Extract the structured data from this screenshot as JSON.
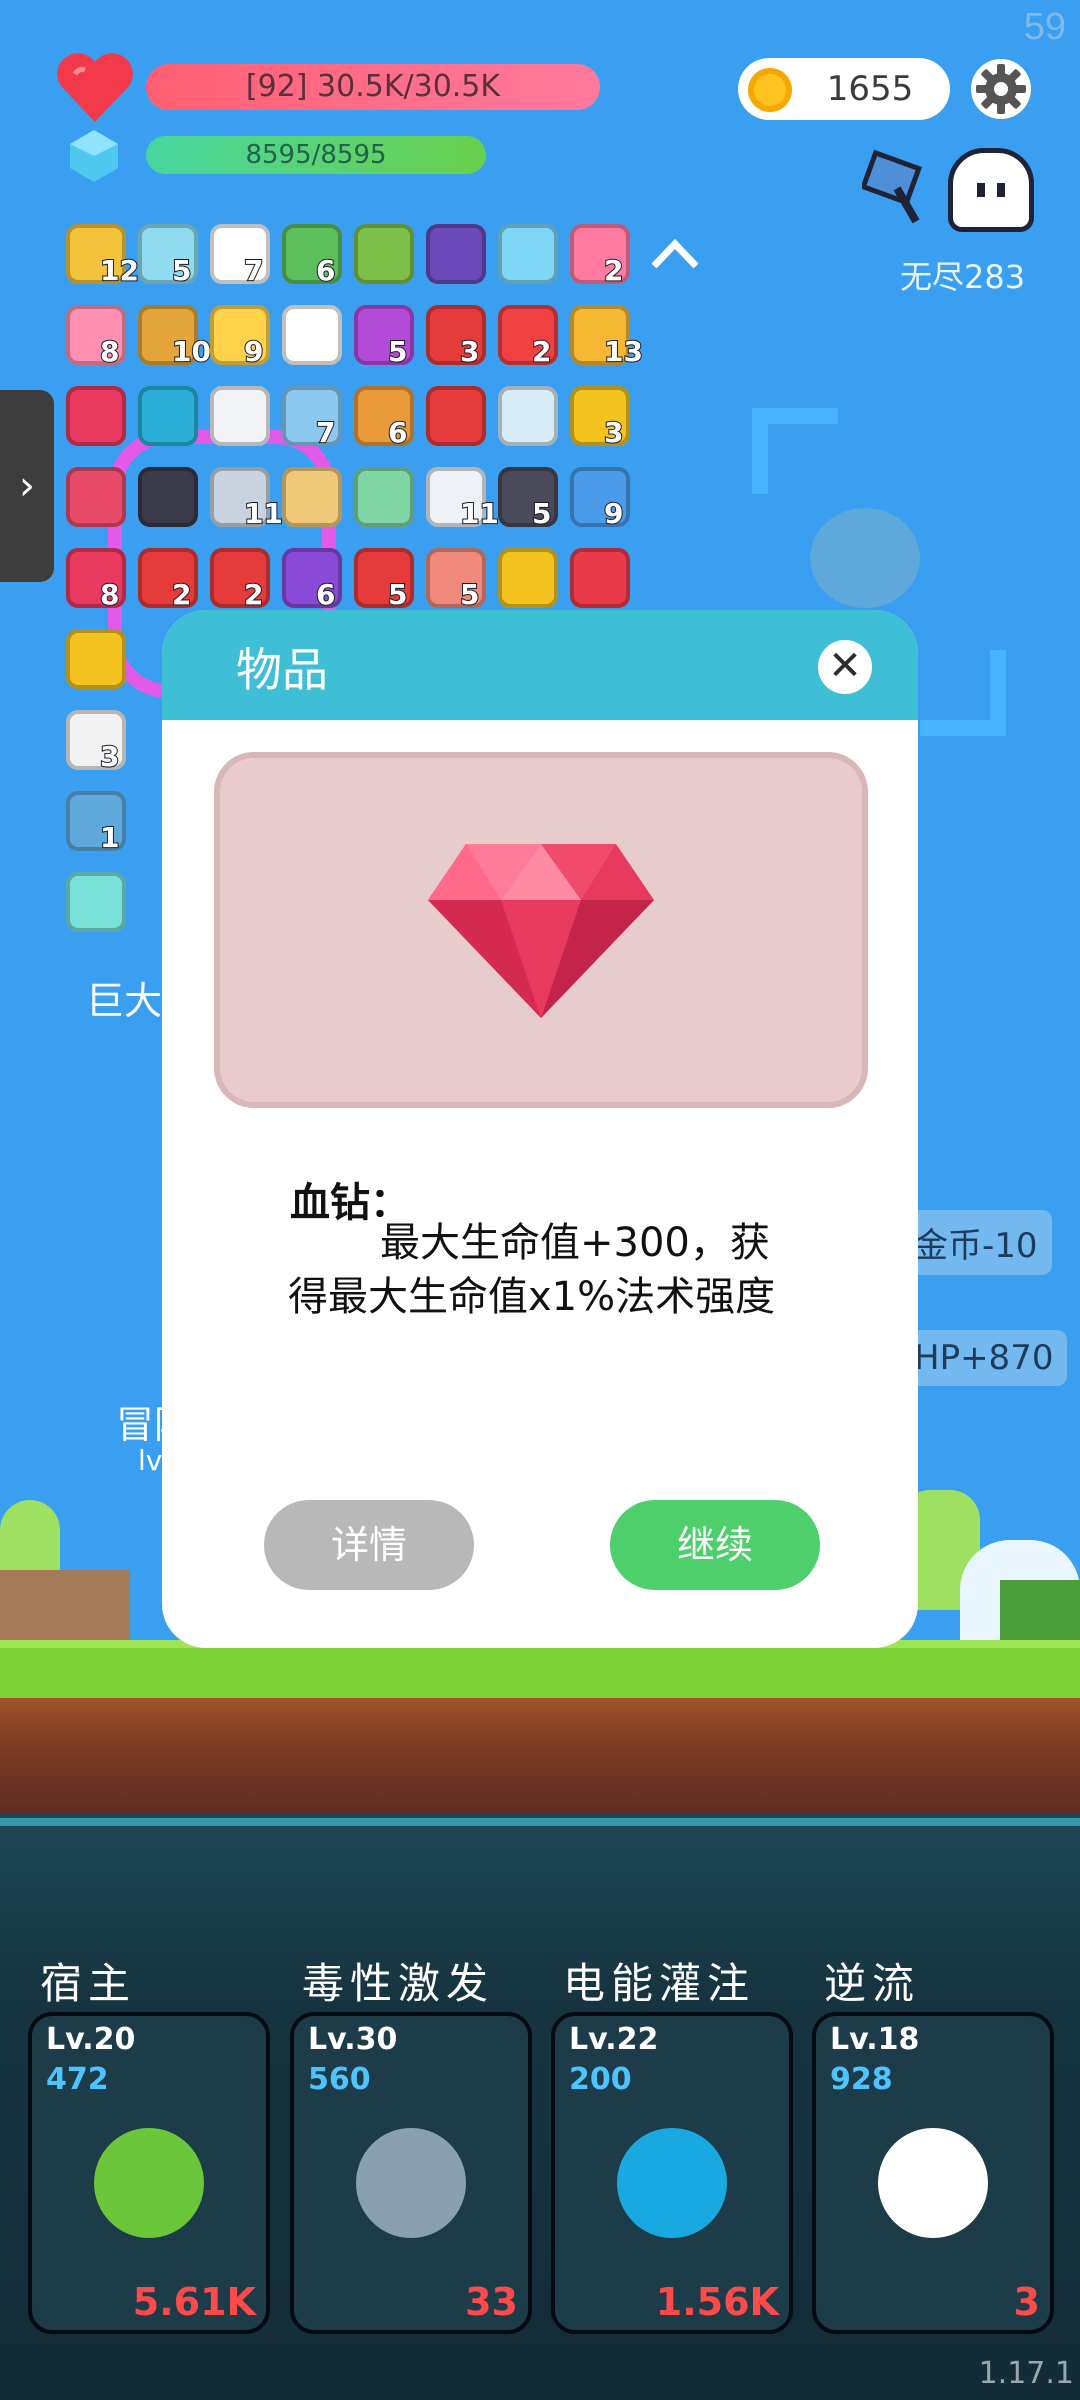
{
  "hud": {
    "fps": "59",
    "hp_text": "[92] 30.5K/30.5K",
    "mp_text": "8595/8595",
    "coins": "1655",
    "endless_label": "无尽283"
  },
  "inventory": {
    "items": [
      {
        "icon": "durian-icon",
        "count": "12",
        "color": "#f3c23b"
      },
      {
        "icon": "syringe-icon",
        "count": "5",
        "color": "#8fdcf0"
      },
      {
        "icon": "ghost-icon",
        "count": "7",
        "color": "#ffffff"
      },
      {
        "icon": "cash-heart-icon",
        "count": "6",
        "color": "#5bbf5b"
      },
      {
        "icon": "potion-flask-icon",
        "count": "",
        "color": "#7cc04a"
      },
      {
        "icon": "wizard-hat-icon",
        "count": "",
        "color": "#6a4ab8"
      },
      {
        "icon": "blue-orb-icon",
        "count": "",
        "color": "#7ed6f6"
      },
      {
        "icon": "spray-bottle-icon",
        "count": "2",
        "color": "#ff7aa0"
      },
      {
        "icon": "ice-cream-icon",
        "count": "8",
        "color": "#ff8fb0"
      },
      {
        "icon": "book-icon",
        "count": "10",
        "color": "#e3a43a"
      },
      {
        "icon": "sun-icon",
        "count": "9",
        "color": "#ffd24a"
      },
      {
        "icon": "tablet-icon",
        "count": "",
        "color": "#ffffff"
      },
      {
        "icon": "crystal-ball-icon",
        "count": "5",
        "color": "#b44ad8"
      },
      {
        "icon": "sock-icon",
        "count": "3",
        "color": "#e63b3b"
      },
      {
        "icon": "pill-icon",
        "count": "2",
        "color": "#f04040"
      },
      {
        "icon": "pineapple-icon",
        "count": "13",
        "color": "#f6b733"
      },
      {
        "icon": "red-gem-icon",
        "count": "",
        "color": "#e8395f"
      },
      {
        "icon": "speech-bubble-icon",
        "count": "",
        "color": "#2ab0d8"
      },
      {
        "icon": "cloud-icon",
        "count": "",
        "color": "#f2f4f7"
      },
      {
        "icon": "shirt-icon",
        "count": "7",
        "color": "#8cc7f0"
      },
      {
        "icon": "briefcase-icon",
        "count": "6",
        "color": "#e89a3a"
      },
      {
        "icon": "magnet-icon",
        "count": "",
        "color": "#e63b3b"
      },
      {
        "icon": "wind-lines-icon",
        "count": "",
        "color": "#d8ecf8"
      },
      {
        "icon": "sunflower-icon",
        "count": "3",
        "color": "#f2c21f"
      },
      {
        "icon": "jam-jar-icon",
        "count": "",
        "color": "#e84a6a"
      },
      {
        "icon": "bat-icon",
        "count": "",
        "color": "#3a3a4a"
      },
      {
        "icon": "sword-icon",
        "count": "11",
        "color": "#c9d3df"
      },
      {
        "icon": "scroll-icon",
        "count": "",
        "color": "#efc979"
      },
      {
        "icon": "alien-icon",
        "count": "",
        "color": "#7fd6a4"
      },
      {
        "icon": "envelope-icon",
        "count": "11",
        "color": "#eef2f6"
      },
      {
        "icon": "skull-book-icon",
        "count": "5",
        "color": "#4a4a5a"
      },
      {
        "icon": "star-card-icon",
        "count": "9",
        "color": "#4a9bea"
      },
      {
        "icon": "target-icon",
        "count": "8",
        "color": "#e8395f"
      },
      {
        "icon": "thermometer-icon",
        "count": "2",
        "color": "#e63b3b"
      },
      {
        "icon": "apple-icon",
        "count": "2",
        "color": "#e63b3b"
      },
      {
        "icon": "star-box-icon",
        "count": "6",
        "color": "#8a4ad8"
      },
      {
        "icon": "mushroom-icon",
        "count": "5",
        "color": "#e63b3b"
      },
      {
        "icon": "steak-icon",
        "count": "5",
        "color": "#ef8a7a"
      },
      {
        "icon": "ring-icon",
        "count": "",
        "color": "#f2c21f"
      },
      {
        "icon": "discount-tag-icon",
        "count": "",
        "color": "#ea3a4a"
      },
      {
        "icon": "magic-wand-icon",
        "count": "",
        "color": "#f2c21f"
      },
      {
        "icon": "dice-icon",
        "count": "3",
        "color": "#f2f2f2"
      },
      {
        "icon": "shield-icon",
        "count": "1",
        "color": "#5fa8dc"
      },
      {
        "icon": "lightbulb-icon",
        "count": "",
        "color": "#78e0d8"
      }
    ],
    "big_text": "巨大"
  },
  "floating_labels": {
    "coins_change": "金币-10",
    "hp_change": "HP+870"
  },
  "character": {
    "name": "冒险",
    "level": "lv"
  },
  "modal": {
    "title": "物品",
    "close_symbol": "✕",
    "item_name": "血钻：",
    "item_desc": "最大生命值+300，获得最大生命值x1%法术强度",
    "detail_button": "详情",
    "continue_button": "继续"
  },
  "skills": [
    {
      "name": "宿主",
      "level": "Lv.20",
      "value": "472",
      "damage": "5.61K",
      "icon": "germ-monster-icon"
    },
    {
      "name": "毒性激发",
      "level": "Lv.30",
      "value": "560",
      "damage": "33",
      "icon": "horned-skull-helmet-icon"
    },
    {
      "name": "电能灌注",
      "level": "Lv.22",
      "value": "200",
      "damage": "1.56K",
      "icon": "lightning-bolt-icon"
    },
    {
      "name": "逆流",
      "level": "Lv.18",
      "value": "928",
      "damage": "3",
      "icon": "white-cloud-icon"
    }
  ],
  "version": "1.17.1",
  "colors": {
    "sky": "#3a9ff0",
    "hp_bar": "#ff6b82",
    "mp_bar": "#5cd27a",
    "modal_header": "#3fbfd6",
    "continue": "#4dcf6c",
    "detail": "#b8b8b8",
    "skill_value": "#4ec4ff",
    "skill_damage": "#ff4a4a"
  }
}
